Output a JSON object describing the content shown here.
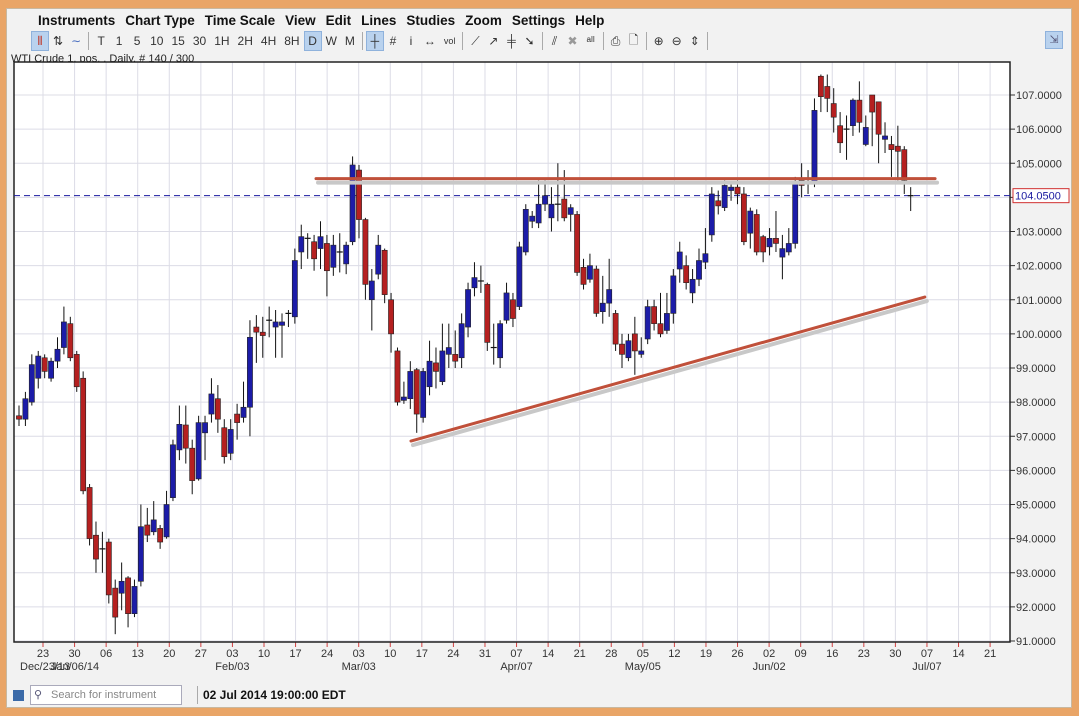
{
  "menu": [
    "Instruments",
    "Chart Type",
    "Time Scale",
    "View",
    "Edit",
    "Lines",
    "Studies",
    "Zoom",
    "Settings",
    "Help"
  ],
  "toolbar": {
    "chart_types": [
      {
        "icon": "candlestick-icon",
        "glyph": "⫴",
        "active": true
      },
      {
        "icon": "ohlc-bar-icon",
        "glyph": "⇅",
        "active": false
      },
      {
        "icon": "line-chart-icon",
        "glyph": "∼",
        "active": false
      }
    ],
    "timescales": [
      {
        "label": "T"
      },
      {
        "label": "1"
      },
      {
        "label": "5"
      },
      {
        "label": "10"
      },
      {
        "label": "15"
      },
      {
        "label": "30"
      },
      {
        "label": "1H"
      },
      {
        "label": "2H"
      },
      {
        "label": "4H"
      },
      {
        "label": "8H"
      },
      {
        "label": "D",
        "active": true
      },
      {
        "label": "W"
      },
      {
        "label": "M"
      }
    ],
    "tools": [
      {
        "icon": "crosshair-icon",
        "glyph": "┼",
        "active": true
      },
      {
        "icon": "grid-icon",
        "glyph": "#"
      },
      {
        "icon": "info-icon",
        "glyph": "i"
      },
      {
        "icon": "scroll-icon",
        "glyph": "↔"
      },
      {
        "icon": "volume-icon",
        "glyph": "vol"
      }
    ],
    "lines": [
      {
        "icon": "trendline-icon",
        "glyph": "⟋"
      },
      {
        "icon": "ray-icon",
        "glyph": "↗"
      },
      {
        "icon": "fibonacci-icon",
        "glyph": "╪"
      },
      {
        "icon": "arrow-icon",
        "glyph": "➘"
      }
    ],
    "edit": [
      {
        "icon": "parallel-lines-icon",
        "glyph": "⫽"
      },
      {
        "icon": "delete-icon",
        "glyph": "✖"
      },
      {
        "icon": "delete-all-icon",
        "glyph": "ᵃˡˡ"
      }
    ],
    "print": [
      {
        "icon": "print-icon",
        "glyph": "⎙"
      },
      {
        "icon": "print-preview-icon",
        "glyph": "🗋"
      }
    ],
    "zoom": [
      {
        "icon": "zoom-in-icon",
        "glyph": "⊕"
      },
      {
        "icon": "zoom-out-icon",
        "glyph": "⊖"
      },
      {
        "icon": "zoom-fit-icon",
        "glyph": "⇕"
      }
    ]
  },
  "chart_info": "WTI Crude 1. pos. , Daily, # 140 / 300",
  "status": {
    "search_placeholder": "Search for instrument",
    "timestamp": "02 Jul 2014 19:00:00 EDT"
  },
  "colors": {
    "up": "#1c1ca8",
    "down": "#b52020",
    "trendline": "#c0503a",
    "price_line": "#1a1aa0"
  },
  "chart_data": {
    "type": "candlestick",
    "ylim": [
      91,
      108
    ],
    "y_ticks": [
      "91.0000",
      "92.0000",
      "93.0000",
      "94.0000",
      "95.0000",
      "96.0000",
      "97.0000",
      "98.0000",
      "99.0000",
      "100.0000",
      "101.0000",
      "102.0000",
      "103.0000",
      "104.0000",
      "105.0000",
      "106.0000",
      "107.0000"
    ],
    "current_price": 104.05,
    "current_price_label": "104.0500",
    "x_ticks": [
      "23",
      "30",
      "06",
      "13",
      "20",
      "27",
      "03",
      "10",
      "17",
      "24",
      "03",
      "10",
      "17",
      "24",
      "31",
      "07",
      "14",
      "21",
      "28",
      "05",
      "12",
      "19",
      "26",
      "02",
      "09",
      "16",
      "23",
      "30",
      "07",
      "14",
      "21"
    ],
    "x_major_labels": [
      {
        "label": "Dec/23/13",
        "tick": 0
      },
      {
        "label": "Jan/06/14",
        "tick": 2
      },
      {
        "label": "Feb/03",
        "tick": 6
      },
      {
        "label": "Mar/03",
        "tick": 10
      },
      {
        "label": "Apr/07",
        "tick": 15
      },
      {
        "label": "May/05",
        "tick": 19
      },
      {
        "label": "Jun/02",
        "tick": 23
      },
      {
        "label": "Jul/07",
        "tick": 28
      }
    ],
    "ohlc": [
      [
        97.6,
        97.9,
        97.3,
        97.5
      ],
      [
        97.5,
        98.3,
        97.3,
        98.1
      ],
      [
        98.0,
        99.4,
        97.9,
        99.1
      ],
      [
        98.7,
        99.5,
        98.4,
        99.35
      ],
      [
        99.3,
        99.4,
        98.7,
        98.9
      ],
      [
        98.7,
        99.3,
        98.6,
        99.2
      ],
      [
        99.2,
        99.9,
        99.0,
        99.55
      ],
      [
        99.6,
        100.8,
        99.4,
        100.35
      ],
      [
        100.3,
        100.5,
        99.2,
        99.3
      ],
      [
        99.4,
        99.5,
        98.3,
        98.45
      ],
      [
        98.7,
        98.9,
        95.3,
        95.4
      ],
      [
        95.5,
        95.6,
        93.8,
        94.0
      ],
      [
        94.1,
        94.5,
        93.0,
        93.4
      ],
      [
        93.7,
        94.2,
        93.0,
        93.7
      ],
      [
        93.9,
        94.0,
        92.1,
        92.35
      ],
      [
        92.55,
        92.8,
        91.2,
        91.7
      ],
      [
        92.4,
        93.3,
        91.9,
        92.75
      ],
      [
        92.85,
        92.9,
        91.4,
        91.8
      ],
      [
        91.8,
        92.8,
        91.7,
        92.6
      ],
      [
        92.75,
        95.0,
        92.6,
        94.35
      ],
      [
        94.4,
        94.9,
        93.9,
        94.1
      ],
      [
        94.2,
        95.1,
        94.1,
        94.55
      ],
      [
        94.3,
        94.4,
        93.7,
        93.9
      ],
      [
        94.05,
        95.4,
        94.0,
        95.0
      ],
      [
        95.2,
        96.9,
        95.1,
        96.75
      ],
      [
        96.6,
        97.9,
        96.3,
        97.35
      ],
      [
        97.33,
        97.9,
        96.2,
        96.65
      ],
      [
        96.65,
        96.9,
        95.3,
        95.7
      ],
      [
        95.75,
        97.6,
        95.7,
        97.4
      ],
      [
        97.1,
        97.6,
        96.3,
        97.4
      ],
      [
        97.65,
        98.7,
        97.4,
        98.24
      ],
      [
        98.1,
        98.5,
        97.1,
        97.5
      ],
      [
        97.25,
        97.5,
        96.2,
        96.4
      ],
      [
        96.5,
        97.5,
        96.3,
        97.2
      ],
      [
        97.65,
        97.95,
        96.9,
        97.4
      ],
      [
        97.55,
        98.6,
        97.4,
        97.85
      ],
      [
        97.85,
        100.4,
        97.0,
        99.9
      ],
      [
        100.2,
        100.55,
        99.15,
        100.05
      ],
      [
        100.05,
        100.5,
        99.3,
        99.95
      ],
      [
        100.4,
        100.8,
        99.9,
        100.4
      ],
      [
        100.2,
        100.7,
        99.3,
        100.35
      ],
      [
        100.25,
        100.6,
        99.3,
        100.35
      ],
      [
        100.6,
        100.7,
        100.2,
        100.6
      ],
      [
        100.5,
        102.5,
        100.3,
        102.15
      ],
      [
        102.4,
        103.2,
        101.9,
        102.85
      ],
      [
        102.8,
        102.95,
        102.2,
        102.8
      ],
      [
        102.7,
        102.9,
        101.85,
        102.2
      ],
      [
        102.5,
        103.3,
        101.9,
        102.85
      ],
      [
        102.65,
        102.9,
        101.1,
        101.85
      ],
      [
        101.95,
        102.9,
        101.7,
        102.6
      ],
      [
        102.4,
        102.95,
        101.8,
        102.4
      ],
      [
        102.05,
        102.7,
        101.75,
        102.6
      ],
      [
        102.7,
        105.2,
        102.6,
        104.95
      ],
      [
        104.8,
        104.95,
        102.8,
        103.35
      ],
      [
        103.35,
        103.4,
        101.0,
        101.45
      ],
      [
        101.0,
        101.9,
        100.1,
        101.55
      ],
      [
        101.75,
        102.9,
        101.6,
        102.6
      ],
      [
        102.45,
        102.5,
        100.9,
        101.15
      ],
      [
        101.0,
        101.2,
        99.45,
        100.0
      ],
      [
        99.5,
        99.6,
        97.9,
        98.0
      ],
      [
        98.05,
        98.6,
        97.95,
        98.15
      ],
      [
        98.1,
        99.2,
        97.8,
        98.9
      ],
      [
        98.95,
        99.0,
        97.1,
        97.65
      ],
      [
        97.55,
        99.0,
        97.4,
        98.9
      ],
      [
        98.45,
        99.8,
        98.2,
        99.2
      ],
      [
        99.15,
        99.6,
        98.4,
        98.9
      ],
      [
        98.6,
        100.3,
        98.5,
        99.5
      ],
      [
        99.4,
        100.3,
        99.0,
        99.6
      ],
      [
        99.4,
        100.1,
        99.0,
        99.2
      ],
      [
        99.3,
        100.6,
        99.0,
        100.3
      ],
      [
        100.2,
        101.5,
        99.9,
        101.3
      ],
      [
        101.35,
        102.1,
        101.1,
        101.65
      ],
      [
        101.55,
        102.0,
        101.2,
        101.55
      ],
      [
        101.45,
        101.5,
        99.5,
        99.75
      ],
      [
        99.6,
        100.3,
        99.1,
        99.6
      ],
      [
        99.3,
        100.4,
        99.0,
        100.3
      ],
      [
        100.4,
        101.5,
        100.3,
        101.2
      ],
      [
        101.0,
        101.2,
        100.2,
        100.45
      ],
      [
        100.8,
        102.7,
        100.7,
        102.55
      ],
      [
        102.4,
        103.8,
        102.3,
        103.65
      ],
      [
        103.3,
        103.6,
        103.1,
        103.45
      ],
      [
        103.25,
        104.5,
        103.1,
        103.8
      ],
      [
        103.8,
        104.5,
        103.6,
        104.05
      ],
      [
        103.4,
        104.3,
        103.0,
        103.8
      ],
      [
        103.8,
        105.0,
        103.3,
        103.8
      ],
      [
        103.95,
        104.8,
        103.3,
        103.4
      ],
      [
        103.5,
        103.8,
        103.0,
        103.7
      ],
      [
        103.5,
        103.6,
        101.7,
        101.8
      ],
      [
        101.95,
        102.2,
        101.3,
        101.45
      ],
      [
        101.6,
        102.35,
        101.5,
        102.0
      ],
      [
        101.9,
        102.0,
        100.5,
        100.6
      ],
      [
        100.65,
        101.7,
        100.3,
        100.9
      ],
      [
        100.9,
        102.2,
        100.5,
        101.3
      ],
      [
        100.6,
        100.7,
        99.5,
        99.7
      ],
      [
        99.7,
        100.0,
        99.0,
        99.4
      ],
      [
        99.3,
        100.0,
        99.2,
        99.8
      ],
      [
        100.0,
        100.5,
        98.8,
        99.5
      ],
      [
        99.4,
        99.9,
        99.3,
        99.5
      ],
      [
        99.85,
        101.0,
        99.7,
        100.8
      ],
      [
        100.8,
        101.0,
        100.1,
        100.3
      ],
      [
        100.3,
        101.2,
        99.9,
        100.0
      ],
      [
        100.1,
        101.2,
        100.0,
        100.6
      ],
      [
        100.6,
        101.9,
        100.3,
        101.7
      ],
      [
        101.9,
        102.7,
        101.5,
        102.4
      ],
      [
        102.0,
        102.3,
        101.3,
        101.5
      ],
      [
        101.2,
        101.9,
        100.9,
        101.6
      ],
      [
        101.6,
        102.5,
        101.4,
        102.15
      ],
      [
        102.1,
        103.1,
        101.9,
        102.35
      ],
      [
        102.9,
        104.3,
        102.7,
        104.1
      ],
      [
        103.9,
        104.2,
        103.5,
        103.75
      ],
      [
        103.7,
        104.5,
        103.6,
        104.35
      ],
      [
        104.2,
        104.4,
        103.9,
        104.3
      ],
      [
        104.3,
        104.5,
        103.8,
        104.1
      ],
      [
        104.1,
        104.3,
        102.6,
        102.7
      ],
      [
        102.95,
        103.7,
        102.5,
        103.6
      ],
      [
        103.5,
        103.65,
        102.3,
        102.4
      ],
      [
        102.85,
        102.9,
        102.1,
        102.4
      ],
      [
        102.55,
        103.1,
        102.3,
        102.8
      ],
      [
        102.8,
        103.6,
        102.4,
        102.65
      ],
      [
        102.25,
        102.9,
        101.6,
        102.5
      ],
      [
        102.4,
        103.1,
        102.3,
        102.65
      ],
      [
        102.65,
        104.6,
        102.5,
        104.4
      ],
      [
        104.5,
        105.0,
        104.0,
        104.35
      ],
      [
        104.4,
        104.8,
        104.1,
        104.4
      ],
      [
        104.4,
        106.9,
        104.3,
        106.55
      ],
      [
        107.55,
        107.6,
        106.5,
        106.95
      ],
      [
        107.25,
        107.6,
        106.5,
        106.9
      ],
      [
        106.75,
        107.2,
        105.9,
        106.35
      ],
      [
        106.1,
        106.5,
        105.3,
        105.6
      ],
      [
        106.0,
        106.4,
        105.1,
        106.0
      ],
      [
        106.1,
        106.9,
        105.8,
        106.85
      ],
      [
        106.85,
        107.4,
        105.9,
        106.2
      ],
      [
        105.55,
        106.4,
        105.5,
        106.05
      ],
      [
        107.0,
        107.0,
        105.5,
        106.5
      ],
      [
        106.8,
        106.8,
        105.0,
        105.85
      ],
      [
        105.7,
        106.2,
        105.3,
        105.8
      ],
      [
        105.55,
        105.8,
        104.6,
        105.4
      ],
      [
        105.5,
        106.1,
        104.5,
        105.35
      ],
      [
        105.4,
        105.5,
        104.1,
        104.5
      ],
      [
        104.05,
        104.3,
        103.6,
        104.05
      ]
    ],
    "drawn_lines": [
      {
        "name": "resistance-line",
        "from": {
          "bar": 47.3,
          "price": 104.55
        },
        "to": {
          "bar": 143.8,
          "price": 104.55
        }
      },
      {
        "name": "support-trendline",
        "from": {
          "bar": 62.1,
          "price": 96.86
        },
        "to": {
          "bar": 142.2,
          "price": 101.08
        }
      }
    ]
  }
}
